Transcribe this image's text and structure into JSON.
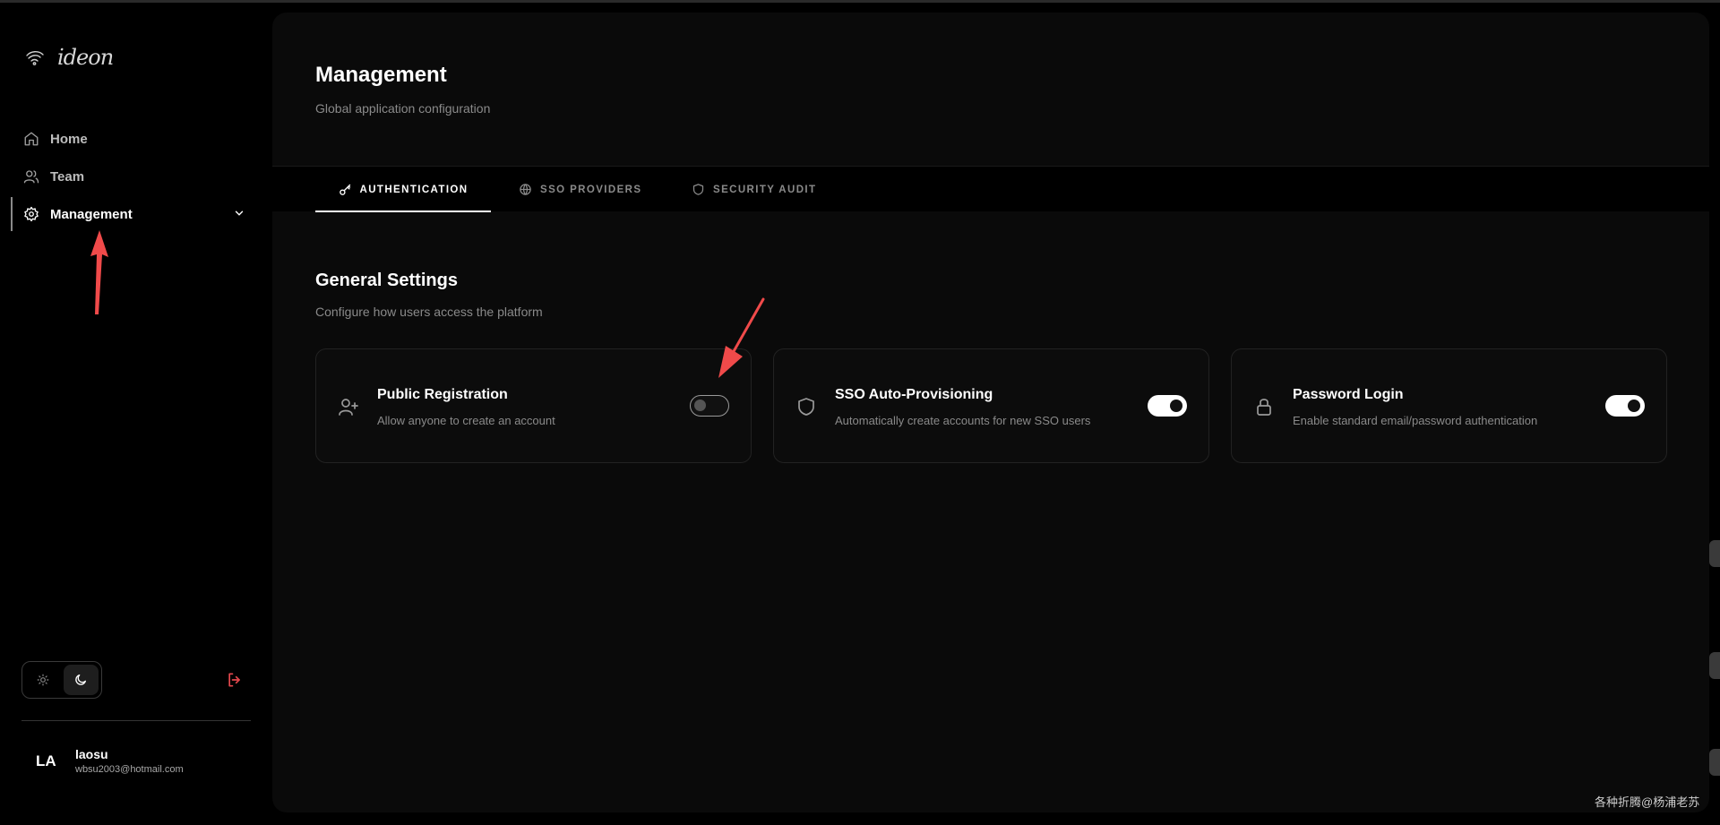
{
  "app": {
    "logo_text": "ideon"
  },
  "sidebar": {
    "items": [
      {
        "label": "Home",
        "icon": "home-icon"
      },
      {
        "label": "Team",
        "icon": "users-icon"
      },
      {
        "label": "Management",
        "icon": "gear-icon",
        "active": true
      }
    ]
  },
  "user": {
    "initials": "LA",
    "name": "laosu",
    "email": "wbsu2003@hotmail.com"
  },
  "page": {
    "title": "Management",
    "subtitle": "Global application configuration"
  },
  "tabs": [
    {
      "label": "AUTHENTICATION",
      "icon": "key-icon",
      "active": true
    },
    {
      "label": "SSO PROVIDERS",
      "icon": "globe-icon"
    },
    {
      "label": "SECURITY AUDIT",
      "icon": "shield-icon"
    }
  ],
  "section": {
    "title": "General Settings",
    "subtitle": "Configure how users access the platform"
  },
  "cards": [
    {
      "title": "Public Registration",
      "desc": "Allow anyone to create an account",
      "icon": "user-plus-icon",
      "enabled": false
    },
    {
      "title": "SSO Auto-Provisioning",
      "desc": "Automatically create accounts for new SSO users",
      "icon": "shield-icon",
      "enabled": true
    },
    {
      "title": "Password Login",
      "desc": "Enable standard email/password authentication",
      "icon": "lock-icon",
      "enabled": true
    }
  ],
  "watermark": "各种折腾@杨浦老苏",
  "colors": {
    "accent": "#ffffff",
    "background": "#000000",
    "panel": "#0a0a0a",
    "logout": "#e5484d",
    "annotation": "#f04a4a"
  }
}
